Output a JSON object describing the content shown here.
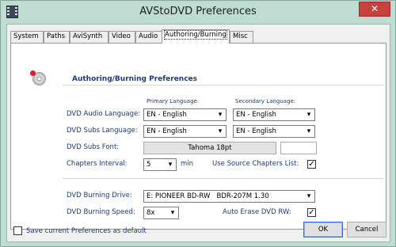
{
  "window": {
    "title": "AVStoDVD Preferences",
    "close_glyph": "✕",
    "accent_color": "#bfdcd2",
    "close_color": "#c7423a"
  },
  "tabs": [
    {
      "label": "System"
    },
    {
      "label": "Paths"
    },
    {
      "label": "AviSynth"
    },
    {
      "label": "Video"
    },
    {
      "label": "Audio"
    },
    {
      "label": "Authoring/Burning",
      "active": true
    },
    {
      "label": "Misc"
    }
  ],
  "section": {
    "title": "Authoring/Burning Preferences",
    "icon": "dvd-disc-icon"
  },
  "language": {
    "primary_header": "Primary Language:",
    "secondary_header": "Secondary Language:",
    "audio_label": "DVD Audio Language:",
    "audio_primary": "EN - English",
    "audio_secondary": "EN - English",
    "subs_label": "DVD Subs Language:",
    "subs_primary": "EN - English",
    "subs_secondary": "EN - English"
  },
  "subs_font": {
    "label": "DVD Subs Font:",
    "value": "Tahoma 18pt"
  },
  "chapters": {
    "label": "Chapters Interval:",
    "value": "5",
    "unit": "min",
    "use_source_label": "Use Source Chapters List:",
    "use_source_checked": true
  },
  "burning": {
    "drive_label": "DVD Burning Drive:",
    "drive_value": "E: PIONEER BD-RW   BDR-207M 1.30",
    "speed_label": "DVD Burning Speed:",
    "speed_value": "8x",
    "auto_erase_label": "Auto Erase DVD RW:",
    "auto_erase_checked": true
  },
  "footer": {
    "save_default_label": "Save current Preferences as default",
    "save_default_checked": false,
    "ok_label": "OK",
    "cancel_label": "Cancel"
  },
  "glyphs": {
    "dropdown_arrow": "▾",
    "check_mark": "✓"
  }
}
